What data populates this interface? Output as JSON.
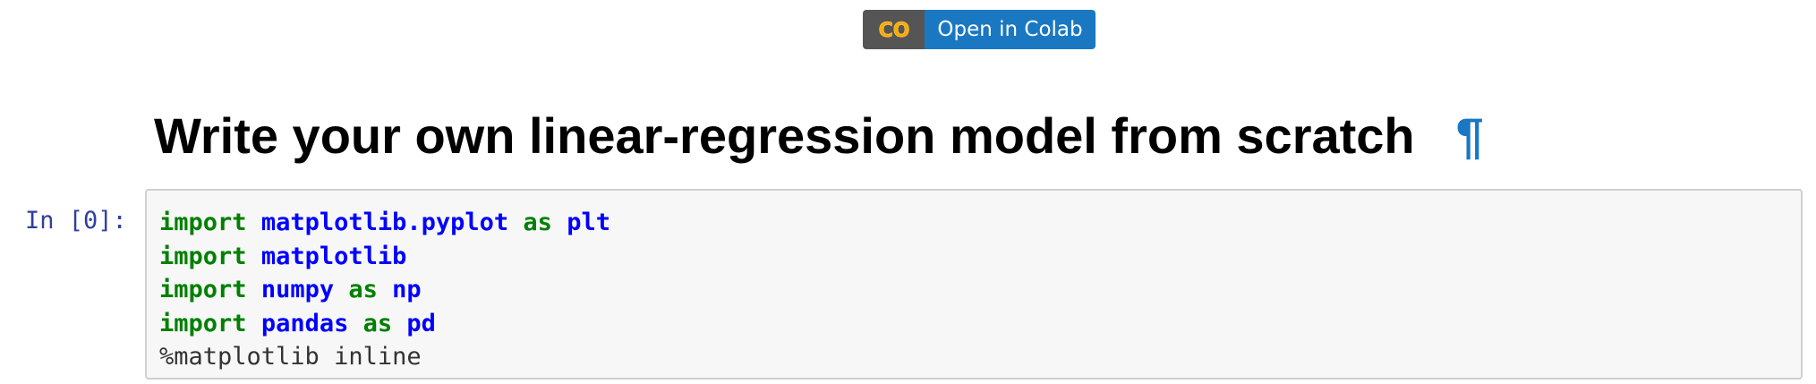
{
  "badge": {
    "logo": "CO",
    "label": "Open in Colab",
    "colors": {
      "left": "#555555",
      "right": "#1a78c2",
      "logo_orange": "#f9ab00",
      "logo_yellow": "#f9c24a"
    }
  },
  "heading": {
    "title": "Write your own linear-regression model from scratch",
    "anchor": "¶",
    "anchor_color": "#1a78c2"
  },
  "cell": {
    "prompt": "In [0]:",
    "lines": [
      {
        "kw1": "import",
        "mod": "matplotlib.pyplot",
        "kw2": "as",
        "alias": "plt"
      },
      {
        "kw1": "import",
        "mod": "matplotlib"
      },
      {
        "kw1": "import",
        "mod": "numpy",
        "kw2": "as",
        "alias": "np"
      },
      {
        "kw1": "import",
        "mod": "pandas",
        "kw2": "as",
        "alias": "pd"
      },
      {
        "magic": "%matplotlib inline"
      }
    ],
    "colors": {
      "keyword": "#008000",
      "module": "#0000ff",
      "prompt": "#303f9f",
      "background": "#f7f7f7",
      "border": "#cfcfcf"
    }
  }
}
